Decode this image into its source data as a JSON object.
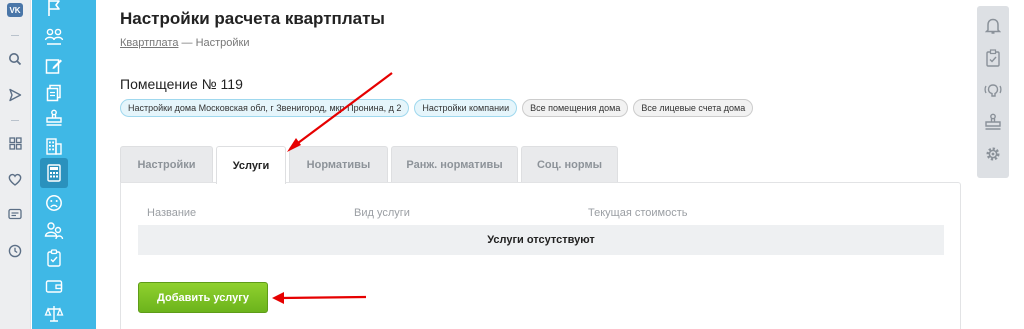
{
  "page": {
    "title": "Настройки расчета квартплаты",
    "breadcrumb": {
      "link": "Квартплата",
      "separator": " — ",
      "current": "Настройки"
    },
    "room_label": "Помещение № 119"
  },
  "chips": [
    "Настройки дома Московская обл, г Звенигород, мкр Пронина, д 2",
    "Настройки компании",
    "Все помещения дома",
    "Все лицевые счета дома"
  ],
  "tabs": [
    "Настройки",
    "Услуги",
    "Нормативы",
    "Ранж. нормативы",
    "Соц. нормы"
  ],
  "active_tab": "Услуги",
  "table": {
    "columns": [
      "Название",
      "Вид услуги",
      "Текущая стоимость"
    ],
    "empty_text": "Услуги отсутствуют"
  },
  "add_button": "Добавить услугу",
  "vk_logo": "VK",
  "colors": {
    "sidebar": "#3fb8e6",
    "accent_green": "#7cc424",
    "annotation_arrow": "#e60000"
  },
  "icons": {
    "vk_rail": [
      "vk-logo",
      "search-icon",
      "send-icon",
      "apps-grid-icon",
      "heart-icon",
      "card-icon",
      "clock-icon"
    ],
    "sidebar": [
      "flag-icon",
      "people-icon",
      "edit-icon",
      "documents-icon",
      "stamp-icon",
      "building-icon",
      "calculator-icon",
      "sad-face-icon",
      "users-icon",
      "clipboard-icon",
      "wallet-icon",
      "scales-icon"
    ],
    "right_rail": [
      "bell-icon",
      "checklist-icon",
      "voice-icon",
      "stamp-icon",
      "gear-icon"
    ]
  }
}
